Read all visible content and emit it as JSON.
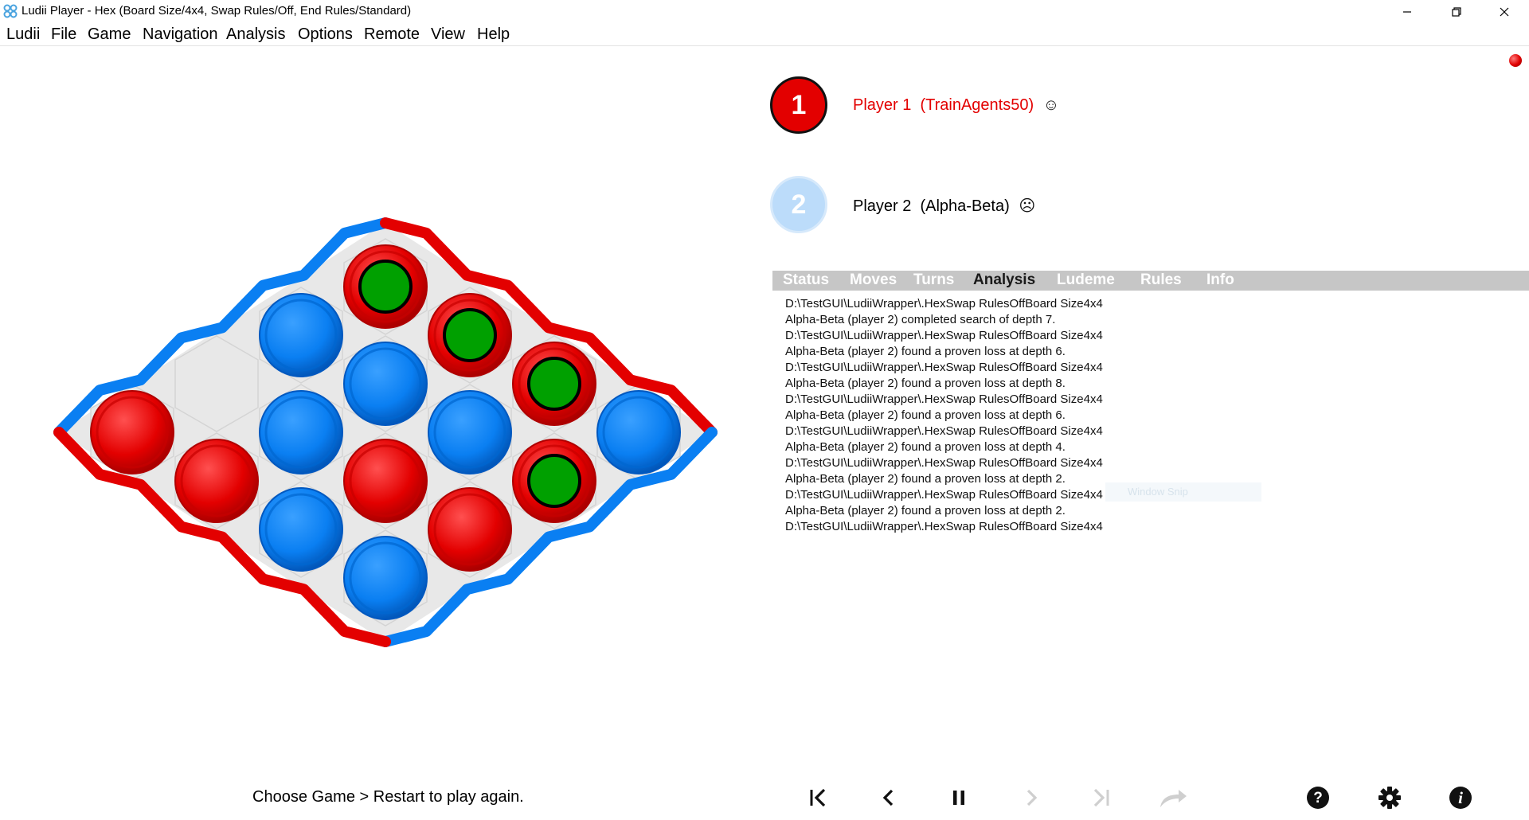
{
  "window": {
    "title": "Ludii Player - Hex (Board Size/4x4, Swap Rules/Off, End Rules/Standard)",
    "minimize_icon": "minimize-icon",
    "restore_icon": "restore-icon",
    "close_icon": "close-icon"
  },
  "menu": [
    "Ludii",
    "File",
    "Game",
    "Navigation",
    "Analysis",
    "Options",
    "Remote",
    "View",
    "Help"
  ],
  "players": [
    {
      "number": "1",
      "label": "Player 1  (TrainAgents50)",
      "color": "#e30000",
      "emoji": "☺",
      "face_icon": "smiley-icon"
    },
    {
      "number": "2",
      "label": "Player 2  (Alpha-Beta)",
      "color": "#000000",
      "emoji": "☹",
      "face_icon": "sad-face-icon"
    }
  ],
  "tabs": [
    "Status",
    "Moves",
    "Turns",
    "Analysis",
    "Ludeme",
    "Rules",
    "Info"
  ],
  "active_tab": "Analysis",
  "log": [
    "D:\\TestGUI\\LudiiWrapper\\.HexSwap RulesOffBoard Size4x4",
    "Alpha-Beta (player 2) completed search of depth 7.",
    "D:\\TestGUI\\LudiiWrapper\\.HexSwap RulesOffBoard Size4x4",
    "Alpha-Beta (player 2) found a proven loss at depth 6.",
    "D:\\TestGUI\\LudiiWrapper\\.HexSwap RulesOffBoard Size4x4",
    "Alpha-Beta (player 2) found a proven loss at depth 8.",
    "D:\\TestGUI\\LudiiWrapper\\.HexSwap RulesOffBoard Size4x4",
    "Alpha-Beta (player 2) found a proven loss at depth 6.",
    "D:\\TestGUI\\LudiiWrapper\\.HexSwap RulesOffBoard Size4x4",
    "Alpha-Beta (player 2) found a proven loss at depth 4.",
    "D:\\TestGUI\\LudiiWrapper\\.HexSwap RulesOffBoard Size4x4",
    "Alpha-Beta (player 2) found a proven loss at depth 2.",
    "D:\\TestGUI\\LudiiWrapper\\.HexSwap RulesOffBoard Size4x4",
    "Alpha-Beta (player 2) found a proven loss at depth 2.",
    "D:\\TestGUI\\LudiiWrapper\\.HexSwap RulesOffBoard Size4x4"
  ],
  "overlay_text": "Window Snip",
  "status_message": "Choose Game > Restart to play again.",
  "board": {
    "game": "Hex",
    "size": "4x4",
    "colors": {
      "player1": "#e30000",
      "player2": "#0a7ff2",
      "winning_marker": "#00a000",
      "empty_cell": "#e8e8e8",
      "cell_line": "#d4d4d4"
    },
    "pieces": [
      {
        "row": 0,
        "col": 0,
        "owner": "player1",
        "win_path": false
      },
      {
        "row": 0,
        "col": 1,
        "owner": "player1",
        "win_path": false
      },
      {
        "row": 0,
        "col": 2,
        "owner": "player2",
        "win_path": false
      },
      {
        "row": 0,
        "col": 3,
        "owner": "player2",
        "win_path": false
      },
      {
        "row": 1,
        "col": 0,
        "owner": null,
        "win_path": false
      },
      {
        "row": 1,
        "col": 1,
        "owner": "player2",
        "win_path": false
      },
      {
        "row": 1,
        "col": 2,
        "owner": "player1",
        "win_path": false
      },
      {
        "row": 1,
        "col": 3,
        "owner": "player1",
        "win_path": false
      },
      {
        "row": 2,
        "col": 0,
        "owner": "player2",
        "win_path": false
      },
      {
        "row": 2,
        "col": 1,
        "owner": "player2",
        "win_path": false
      },
      {
        "row": 2,
        "col": 2,
        "owner": "player2",
        "win_path": false
      },
      {
        "row": 2,
        "col": 3,
        "owner": "player1",
        "win_path": true
      },
      {
        "row": 3,
        "col": 0,
        "owner": "player1",
        "win_path": true
      },
      {
        "row": 3,
        "col": 1,
        "owner": "player1",
        "win_path": true
      },
      {
        "row": 3,
        "col": 2,
        "owner": "player1",
        "win_path": true
      },
      {
        "row": 3,
        "col": 3,
        "owner": "player2",
        "win_path": false
      }
    ]
  },
  "controls": [
    {
      "name": "jump-to-start-button",
      "icon": "skip-to-start-icon",
      "enabled": true
    },
    {
      "name": "step-back-button",
      "icon": "back-arrow-icon",
      "enabled": true
    },
    {
      "name": "pause-button",
      "icon": "pause-icon",
      "enabled": true
    },
    {
      "name": "step-forward-button",
      "icon": "forward-arrow-icon",
      "enabled": false
    },
    {
      "name": "jump-to-end-button",
      "icon": "skip-to-end-icon",
      "enabled": false
    },
    {
      "name": "redo-button",
      "icon": "redo-arrow-icon",
      "enabled": false
    },
    {
      "name": "help-button",
      "icon": "question-icon",
      "enabled": true
    },
    {
      "name": "settings-button",
      "icon": "gear-icon",
      "enabled": true
    },
    {
      "name": "info-button",
      "icon": "info-icon",
      "enabled": true
    }
  ],
  "connection_indicator_color": "#e00000"
}
